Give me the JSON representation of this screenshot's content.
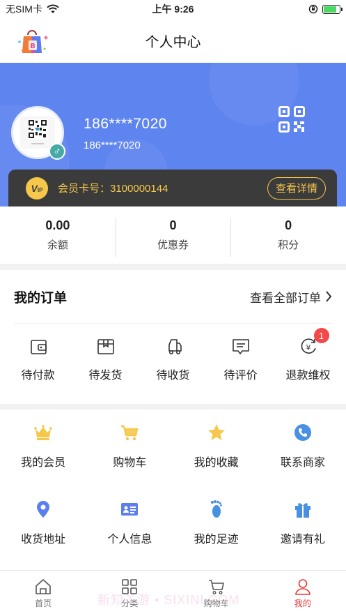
{
  "status_bar": {
    "carrier": "无SIM卡",
    "time": "上午 9:26"
  },
  "header": {
    "title": "个人中心"
  },
  "profile": {
    "phone_main": "186****7020",
    "phone_sub": "186****7020",
    "gender_symbol": "♂",
    "bg_color": "#5e84f0"
  },
  "vip": {
    "badge_text": "V",
    "badge_sub": "IP",
    "card_label": "会员卡号：3100000144",
    "details_button": "查看详情",
    "accent_color": "#f5c84c"
  },
  "stats": [
    {
      "value": "0.00",
      "label": "余额"
    },
    {
      "value": "0",
      "label": "优惠券"
    },
    {
      "value": "0",
      "label": "积分"
    }
  ],
  "orders": {
    "title": "我的订单",
    "view_all": "查看全部订单",
    "items": [
      {
        "label": "待付款",
        "icon": "wallet-icon"
      },
      {
        "label": "待发货",
        "icon": "package-icon"
      },
      {
        "label": "待收货",
        "icon": "truck-icon"
      },
      {
        "label": "待评价",
        "icon": "comment-icon"
      },
      {
        "label": "退款维权",
        "icon": "refund-icon",
        "badge": "1"
      }
    ]
  },
  "services": [
    {
      "label": "我的会员",
      "icon": "crown-icon",
      "color": "#f5c84c"
    },
    {
      "label": "购物车",
      "icon": "cart-icon",
      "color": "#f5c84c"
    },
    {
      "label": "我的收藏",
      "icon": "star-icon",
      "color": "#f5c84c"
    },
    {
      "label": "联系商家",
      "icon": "phone-icon",
      "color": "#4a90e2"
    },
    {
      "label": "收货地址",
      "icon": "location-icon",
      "color": "#5b7ff0"
    },
    {
      "label": "个人信息",
      "icon": "id-card-icon",
      "color": "#5b7ff0"
    },
    {
      "label": "我的足迹",
      "icon": "footprint-icon",
      "color": "#4a90e2"
    },
    {
      "label": "邀请有礼",
      "icon": "gift-icon",
      "color": "#4a90e2"
    }
  ],
  "tabbar": [
    {
      "label": "首页",
      "icon": "home-icon",
      "active": false
    },
    {
      "label": "分类",
      "icon": "grid-icon",
      "active": false
    },
    {
      "label": "购物车",
      "icon": "cart-icon",
      "active": false
    },
    {
      "label": "我的",
      "icon": "user-icon",
      "active": true
    }
  ],
  "watermark": "新知丫游 • SIXINI.COM"
}
